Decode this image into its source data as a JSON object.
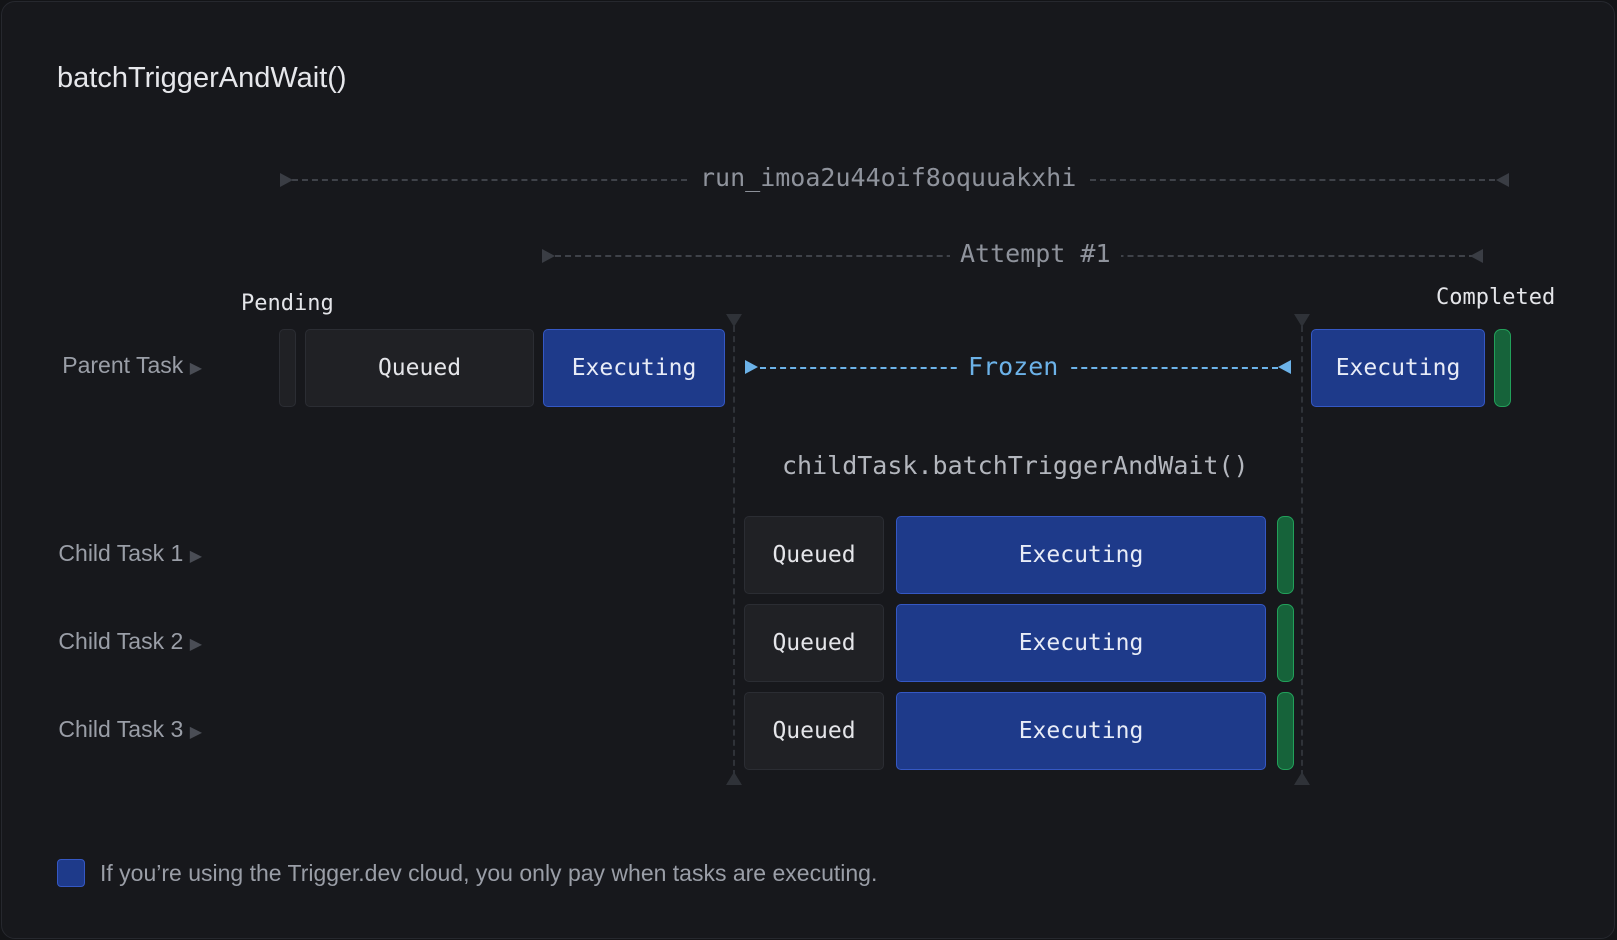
{
  "title": "batchTriggerAndWait()",
  "run_id": "run_imoa2u44oif8oquuakxhi",
  "attempt": "Attempt #1",
  "states": {
    "pending": "Pending",
    "completed": "Completed",
    "frozen": "Frozen"
  },
  "parent": {
    "label": "Parent Task",
    "queued": "Queued",
    "executing_1": "Executing",
    "executing_2": "Executing"
  },
  "call": "childTask.batchTriggerAndWait()",
  "children": [
    {
      "label": "Child Task 1",
      "queued": "Queued",
      "executing": "Executing"
    },
    {
      "label": "Child Task 2",
      "queued": "Queued",
      "executing": "Executing"
    },
    {
      "label": "Child Task 3",
      "queued": "Queued",
      "executing": "Executing"
    }
  ],
  "note": "If you’re using the Trigger.dev cloud, you only pay when tasks are executing.",
  "colors": {
    "background": "#17181c",
    "executing": "#1e3a8a",
    "completed": "#16633a",
    "frozen": "#6cb2e8",
    "queued": "#202125"
  }
}
